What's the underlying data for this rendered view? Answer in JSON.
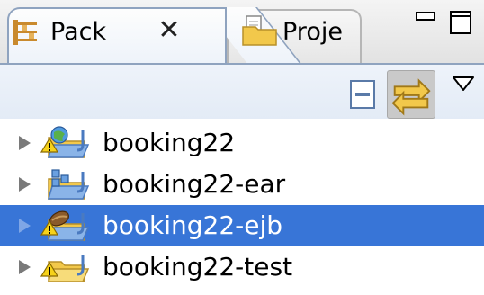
{
  "tabs": [
    {
      "label": "Pack",
      "icon": "package-explorer-icon",
      "active": true,
      "closable": true
    },
    {
      "label": "Proje",
      "icon": "folder-icon",
      "active": false
    }
  ],
  "window_controls": {
    "minimize": "minimize-icon",
    "maximize": "maximize-icon"
  },
  "toolbar": {
    "items": [
      "collapse-all-icon",
      "link-with-editor-icon",
      "view-menu-icon"
    ]
  },
  "tree": {
    "items": [
      {
        "label": "booking22",
        "icon": "web-project-icon",
        "warning": true,
        "selected": false
      },
      {
        "label": "booking22-ear",
        "icon": "ear-project-icon",
        "warning": false,
        "selected": false
      },
      {
        "label": "booking22-ejb",
        "icon": "ejb-project-icon",
        "warning": true,
        "selected": true
      },
      {
        "label": "booking22-test",
        "icon": "test-project-icon",
        "warning": true,
        "selected": false
      }
    ]
  },
  "colors": {
    "selection": "#3875d7",
    "tab_border": "#8fa3bf",
    "folder": "#f2c84b"
  }
}
